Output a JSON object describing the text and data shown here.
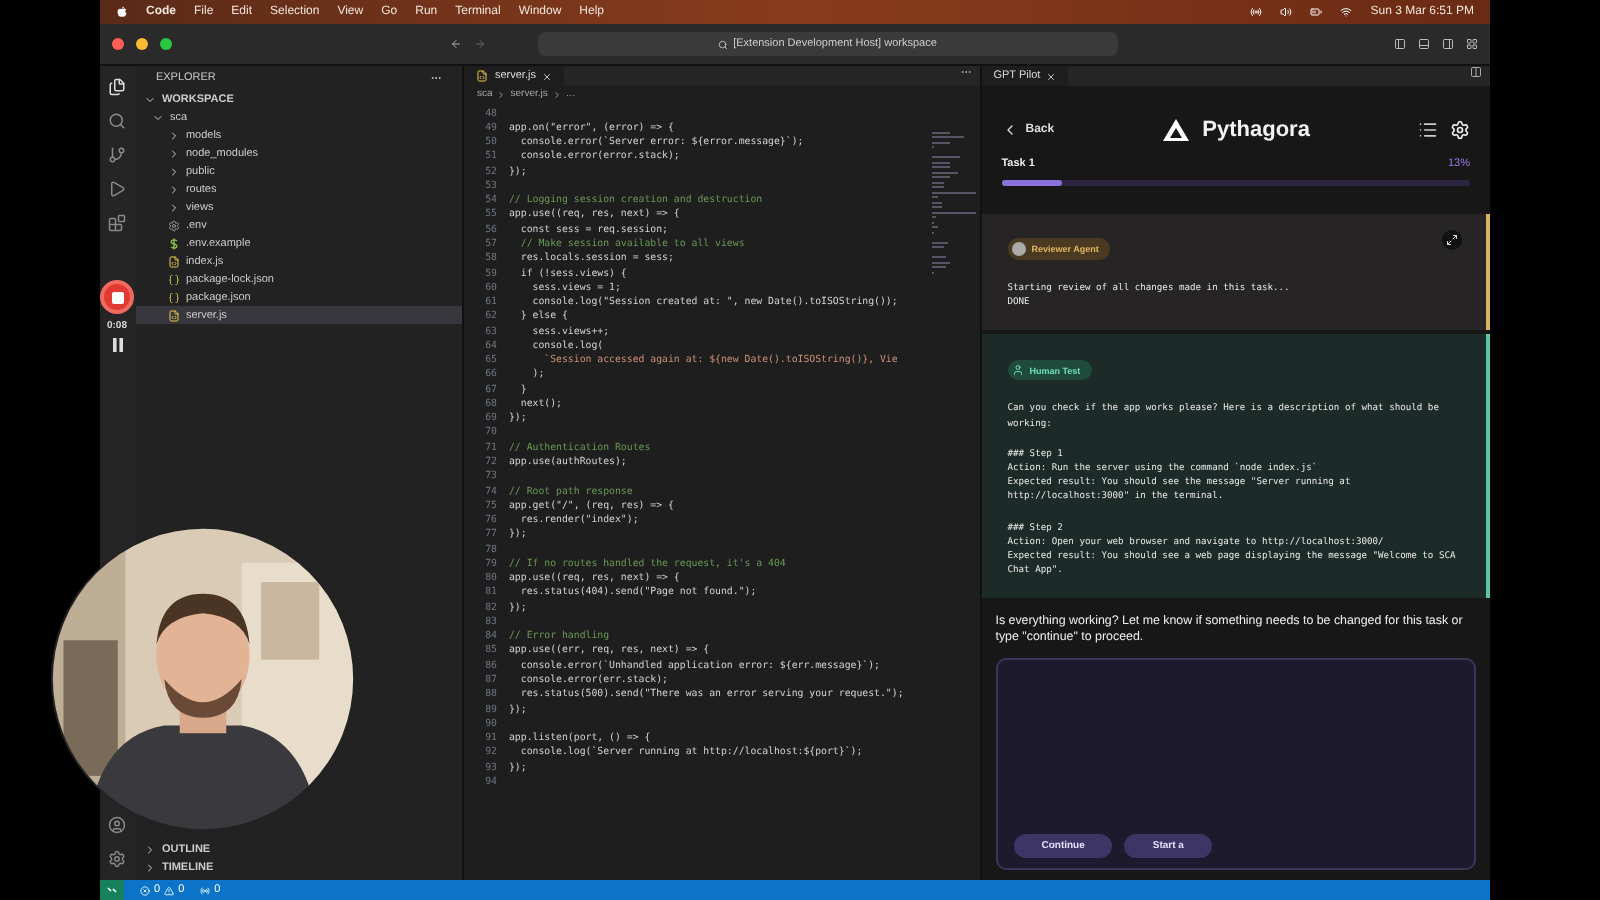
{
  "menu_bar": {
    "app": "Code",
    "items": [
      "File",
      "Edit",
      "Selection",
      "View",
      "Go",
      "Run",
      "Terminal",
      "Window",
      "Help"
    ],
    "clock": "Sun 3 Mar 6:51 PM"
  },
  "title_bar": {
    "search": "[Extension Development Host] workspace"
  },
  "recording": {
    "time": "0:08"
  },
  "explorer": {
    "title": "EXPLORER",
    "section": "WORKSPACE",
    "tree": [
      {
        "label": "sca",
        "kind": "folder",
        "expanded": true,
        "selected": false,
        "children": [
          {
            "label": "models",
            "kind": "folder",
            "expanded": false,
            "selected": false
          },
          {
            "label": "node_modules",
            "kind": "folder",
            "expanded": false,
            "selected": false
          },
          {
            "label": "public",
            "kind": "folder",
            "expanded": false,
            "selected": false
          },
          {
            "label": "routes",
            "kind": "folder",
            "expanded": false,
            "selected": false
          },
          {
            "label": "views",
            "kind": "folder",
            "expanded": false,
            "selected": false
          },
          {
            "label": ".env",
            "kind": "env",
            "selected": false
          },
          {
            "label": ".env.example",
            "kind": "shell",
            "selected": false
          },
          {
            "label": "index.js",
            "kind": "js",
            "selected": false
          },
          {
            "label": "package-lock.json",
            "kind": "json",
            "selected": false
          },
          {
            "label": "package.json",
            "kind": "json",
            "selected": false
          },
          {
            "label": "server.js",
            "kind": "js",
            "selected": true
          }
        ]
      }
    ],
    "bottom_sections": [
      "OUTLINE",
      "TIMELINE"
    ]
  },
  "editor": {
    "tab": "server.js",
    "breadcrumb": [
      "sca",
      "server.js",
      "…"
    ],
    "lines": [
      {
        "number": "48"
      },
      {
        "number": "49",
        "kind": "code",
        "text": "app.on(\"error\", (error) => {"
      },
      {
        "number": "50",
        "kind": "code",
        "text": "  console.error(`Server error: ${error.message}`);"
      },
      {
        "number": "51",
        "kind": "code",
        "text": "  console.error(error.stack);"
      },
      {
        "number": "52",
        "kind": "code",
        "text": "});"
      },
      {
        "number": "53"
      },
      {
        "number": "54",
        "kind": "comment",
        "text": "// Logging session creation and destruction"
      },
      {
        "number": "55",
        "kind": "code",
        "text": "app.use((req, res, next) => {"
      },
      {
        "number": "56",
        "kind": "code",
        "text": "  const sess = req.session;"
      },
      {
        "number": "57",
        "kind": "comment",
        "text": "  // Make session available to all views"
      },
      {
        "number": "58",
        "kind": "code",
        "text": "  res.locals.session = sess;"
      },
      {
        "number": "59",
        "kind": "code",
        "text": "  if (!sess.views) {"
      },
      {
        "number": "60",
        "kind": "code",
        "text": "    sess.views = 1;"
      },
      {
        "number": "61",
        "kind": "code",
        "text": "    console.log(\"Session created at: \", new Date().toISOString());"
      },
      {
        "number": "62",
        "kind": "code",
        "text": "  } else {"
      },
      {
        "number": "63",
        "kind": "code",
        "text": "    sess.views++;"
      },
      {
        "number": "64",
        "kind": "code",
        "text": "    console.log("
      },
      {
        "number": "65",
        "kind": "string",
        "text": "      `Session accessed again at: ${new Date().toISOString()}, Vie"
      },
      {
        "number": "66",
        "kind": "code",
        "text": "    );"
      },
      {
        "number": "67",
        "kind": "code",
        "text": "  }"
      },
      {
        "number": "68",
        "kind": "code",
        "text": "  next();"
      },
      {
        "number": "69",
        "kind": "code",
        "text": "});"
      },
      {
        "number": "70"
      },
      {
        "number": "71",
        "kind": "comment",
        "text": "// Authentication Routes"
      },
      {
        "number": "72",
        "kind": "code",
        "text": "app.use(authRoutes);"
      },
      {
        "number": "73"
      },
      {
        "number": "74",
        "kind": "comment",
        "text": "// Root path response"
      },
      {
        "number": "75",
        "kind": "code",
        "text": "app.get(\"/\", (req, res) => {"
      },
      {
        "number": "76",
        "kind": "code",
        "text": "  res.render(\"index\");"
      },
      {
        "number": "77",
        "kind": "code",
        "text": "});"
      },
      {
        "number": "78"
      },
      {
        "number": "79",
        "kind": "comment",
        "text": "// If no routes handled the request, it's a 404"
      },
      {
        "number": "80",
        "kind": "code",
        "text": "app.use((req, res, next) => {"
      },
      {
        "number": "81",
        "kind": "code",
        "text": "  res.status(404).send(\"Page not found.\");"
      },
      {
        "number": "82",
        "kind": "code",
        "text": "});"
      },
      {
        "number": "83"
      },
      {
        "number": "84",
        "kind": "comment",
        "text": "// Error handling"
      },
      {
        "number": "85",
        "kind": "code",
        "text": "app.use((err, req, res, next) => {"
      },
      {
        "number": "86",
        "kind": "code",
        "text": "  console.error(`Unhandled application error: ${err.message}`);"
      },
      {
        "number": "87",
        "kind": "code",
        "text": "  console.error(err.stack);"
      },
      {
        "number": "88",
        "kind": "code",
        "text": "  res.status(500).send(\"There was an error serving your request.\");"
      },
      {
        "number": "89",
        "kind": "code",
        "text": "});"
      },
      {
        "number": "90"
      },
      {
        "number": "91",
        "kind": "code",
        "text": "app.listen(port, () => {"
      },
      {
        "number": "92",
        "kind": "code",
        "text": "  console.log(`Server running at http://localhost:${port}`);"
      },
      {
        "number": "93",
        "kind": "code",
        "text": "});"
      },
      {
        "number": "94"
      }
    ]
  },
  "panel": {
    "tab": "GPT Pilot",
    "back": "Back",
    "brand": "Pythagora",
    "task": {
      "label": "Task 1",
      "percent": "13%",
      "level": 0.13
    },
    "messages": [
      {
        "agent": "Reviewer Agent",
        "kind": "reviewer",
        "paragraphs": [
          [
            "Starting review of all changes made in this task...",
            "DONE"
          ]
        ]
      },
      {
        "agent": "Human Test",
        "kind": "human",
        "paragraphs": [
          [
            "Can you check if the app works please? Here is a description of what should be working:"
          ],
          [
            "### Step 1",
            "Action: Run the server using the command `node index.js`",
            "Expected result: You should see the message \"Server running at http://localhost:3000\" in the terminal."
          ],
          [
            "### Step 2",
            "Action: Open your web browser and navigate to http://localhost:3000/",
            "Expected result: You should see a web page displaying the message \"Welcome to SCA Chat App\"."
          ]
        ]
      }
    ],
    "question": "Is everything working? Let me know if something needs to be changed for this task or type \"continue\" to proceed.",
    "buttons": [
      "Continue",
      "Start a"
    ]
  },
  "status_bar": {
    "errors": "0",
    "warnings": "0",
    "ports": "0"
  }
}
